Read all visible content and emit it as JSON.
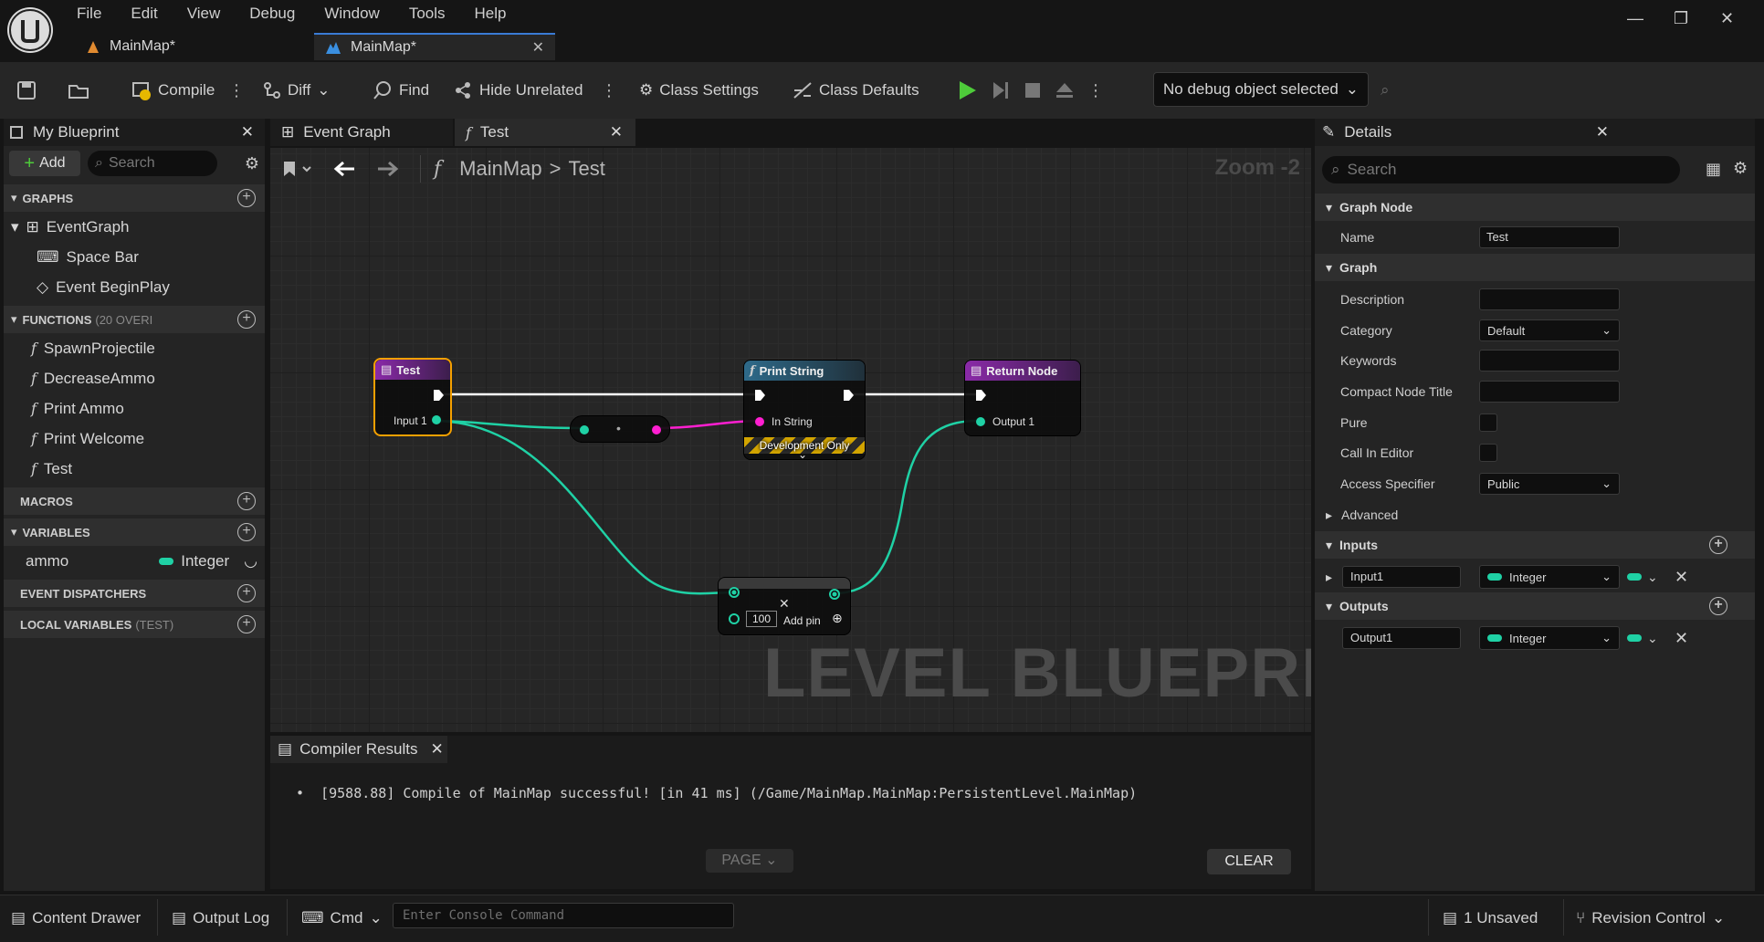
{
  "menu": [
    "File",
    "Edit",
    "View",
    "Debug",
    "Window",
    "Tools",
    "Help"
  ],
  "doc_tabs": [
    {
      "label": "MainMap*"
    },
    {
      "label": "MainMap*"
    }
  ],
  "toolbar": {
    "compile": "Compile",
    "diff": "Diff",
    "find": "Find",
    "hide_unrelated": "Hide Unrelated",
    "class_settings": "Class Settings",
    "class_defaults": "Class Defaults",
    "debug_object": "No debug object selected"
  },
  "my_blueprint": {
    "title": "My Blueprint",
    "add": "Add",
    "search_placeholder": "Search",
    "graphs_header": "GRAPHS",
    "graphs": [
      {
        "label": "EventGraph"
      },
      {
        "label": "Space Bar"
      },
      {
        "label": "Event BeginPlay"
      }
    ],
    "functions_header": "FUNCTIONS",
    "functions_note": "(20 OVERI",
    "functions": [
      "SpawnProjectile",
      "DecreaseAmmo",
      "Print Ammo",
      "Print Welcome",
      "Test"
    ],
    "macros_header": "MACROS",
    "variables_header": "VARIABLES",
    "variables": [
      {
        "name": "ammo",
        "type": "Integer",
        "color": "#1fd1a5"
      }
    ],
    "dispatchers_header": "EVENT DISPATCHERS",
    "local_vars_header": "LOCAL VARIABLES",
    "local_vars_note": "(TEST)"
  },
  "graph_tabs": [
    {
      "label": "Event Graph"
    },
    {
      "label": "Test"
    }
  ],
  "graph": {
    "breadcrumb_root": "MainMap",
    "breadcrumb_separator": ">",
    "breadcrumb_leaf": "Test",
    "zoom": "Zoom -2",
    "watermark": "LEVEL BLUEPRINT",
    "nodes": {
      "entry_title": "Test",
      "entry_pin": "Input 1",
      "print_title": "Print String",
      "print_pin": "In String",
      "print_banner": "Development Only",
      "return_title": "Return Node",
      "return_pin": "Output 1",
      "add_value": "100",
      "add_pin": "Add pin"
    },
    "colors": {
      "exec": "#ffffff",
      "integer": "#1fd1a5",
      "string": "#ff1fd1"
    }
  },
  "compiler": {
    "title": "Compiler Results",
    "message": "[9588.88] Compile of MainMap successful! [in 41 ms] (/Game/MainMap.MainMap:PersistentLevel.MainMap)",
    "page": "PAGE",
    "clear": "CLEAR"
  },
  "details": {
    "title": "Details",
    "search_placeholder": "Search",
    "sections": {
      "graph_node": "Graph Node",
      "graph": "Graph",
      "advanced": "Advanced",
      "inputs": "Inputs",
      "outputs": "Outputs"
    },
    "name_label": "Name",
    "name_value": "Test",
    "description_label": "Description",
    "category_label": "Category",
    "category_value": "Default",
    "keywords_label": "Keywords",
    "compact_title_label": "Compact Node Title",
    "pure_label": "Pure",
    "call_in_editor_label": "Call In Editor",
    "access_label": "Access Specifier",
    "access_value": "Public",
    "input_name": "Input1",
    "input_type": "Integer",
    "output_name": "Output1",
    "output_type": "Integer"
  },
  "statusbar": {
    "content_drawer": "Content Drawer",
    "output_log": "Output Log",
    "cmd": "Cmd",
    "console_placeholder": "Enter Console Command",
    "unsaved": "1 Unsaved",
    "revision_control": "Revision Control"
  }
}
